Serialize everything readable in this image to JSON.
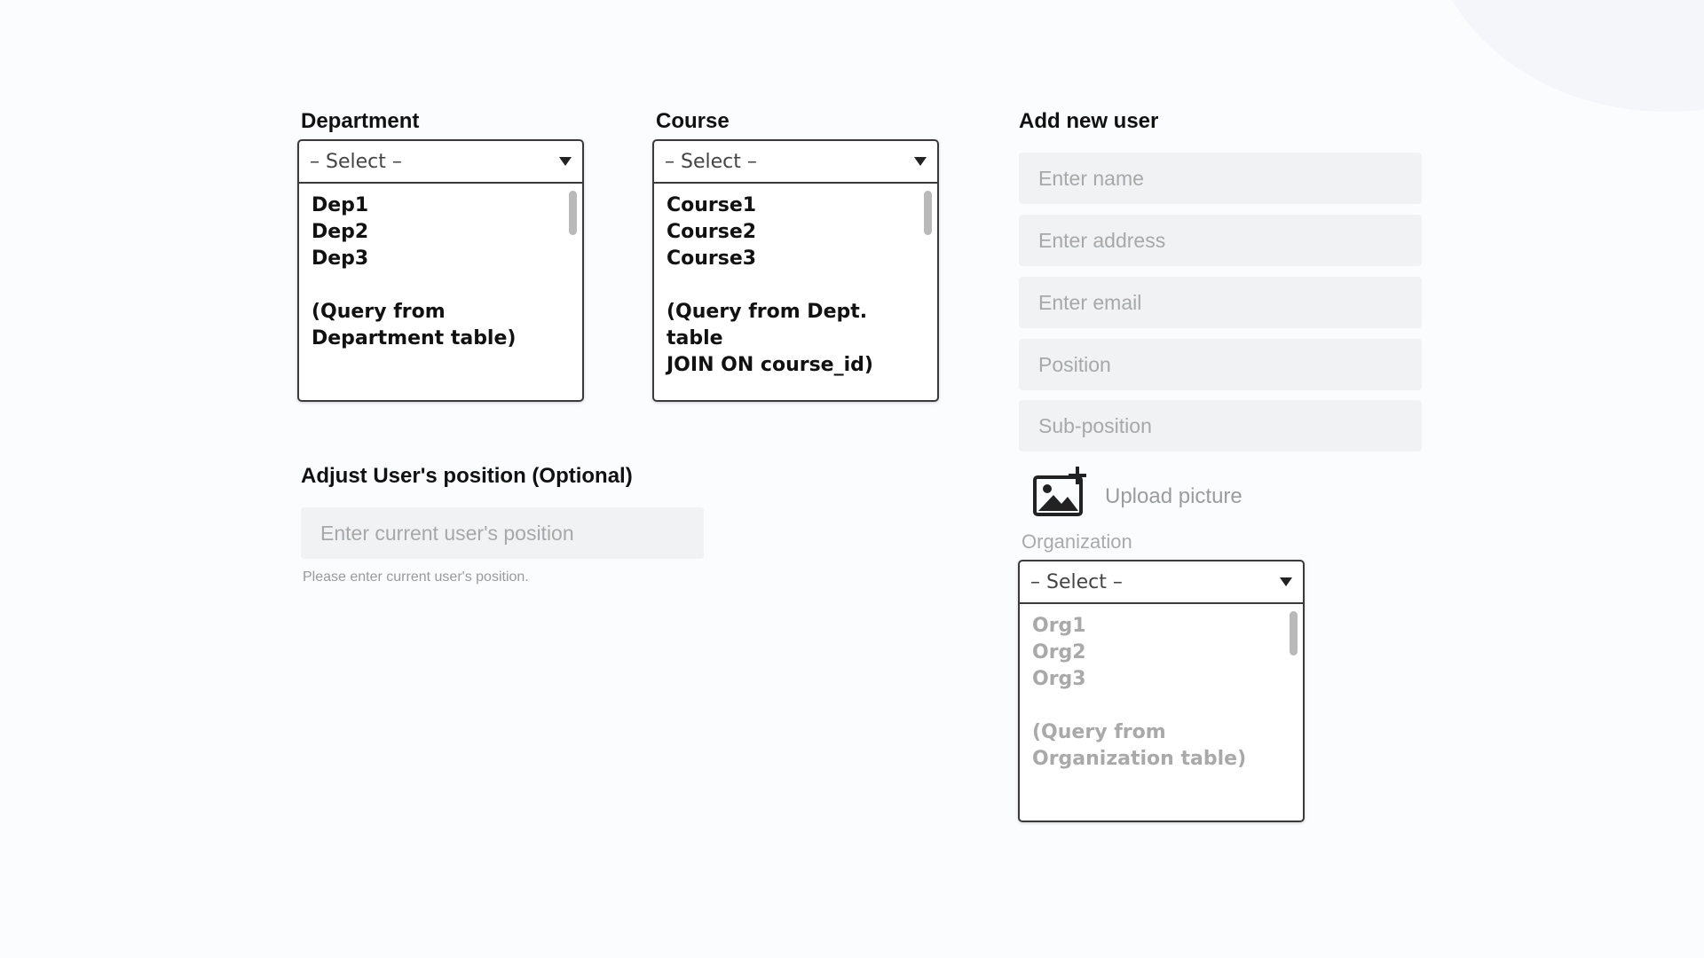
{
  "department": {
    "label": "Department",
    "selected": "– Select –",
    "options": [
      "Dep1",
      "Dep2",
      "Dep3"
    ],
    "note_line1": "(Query from",
    "note_line2": "Department table)"
  },
  "course": {
    "label": "Course",
    "selected": "– Select –",
    "options": [
      "Course1",
      "Course2",
      "Course3"
    ],
    "note_line1": "(Query from Dept. table",
    "note_line2": "JOIN ON course_id)"
  },
  "adjust": {
    "label": "Adjust User's position (Optional)",
    "placeholder": "Enter current user's position",
    "helper": "Please enter current user's position."
  },
  "add_user": {
    "label": "Add new user",
    "name_placeholder": "Enter name",
    "address_placeholder": "Enter address",
    "email_placeholder": "Enter email",
    "position_placeholder": "Position",
    "subposition_placeholder": "Sub-position",
    "upload_label": "Upload picture",
    "upload_icon": "add-image-icon"
  },
  "organization": {
    "label": "Organization",
    "selected": "– Select –",
    "options": [
      "Org1",
      "Org2",
      "Org3"
    ],
    "note_line1": "(Query from",
    "note_line2": "Organization table)"
  },
  "colors": {
    "background": "#fbfcfe",
    "field_bg": "#f1f2f4",
    "border": "#3a3a3a",
    "muted_text": "#a9a9a9"
  }
}
